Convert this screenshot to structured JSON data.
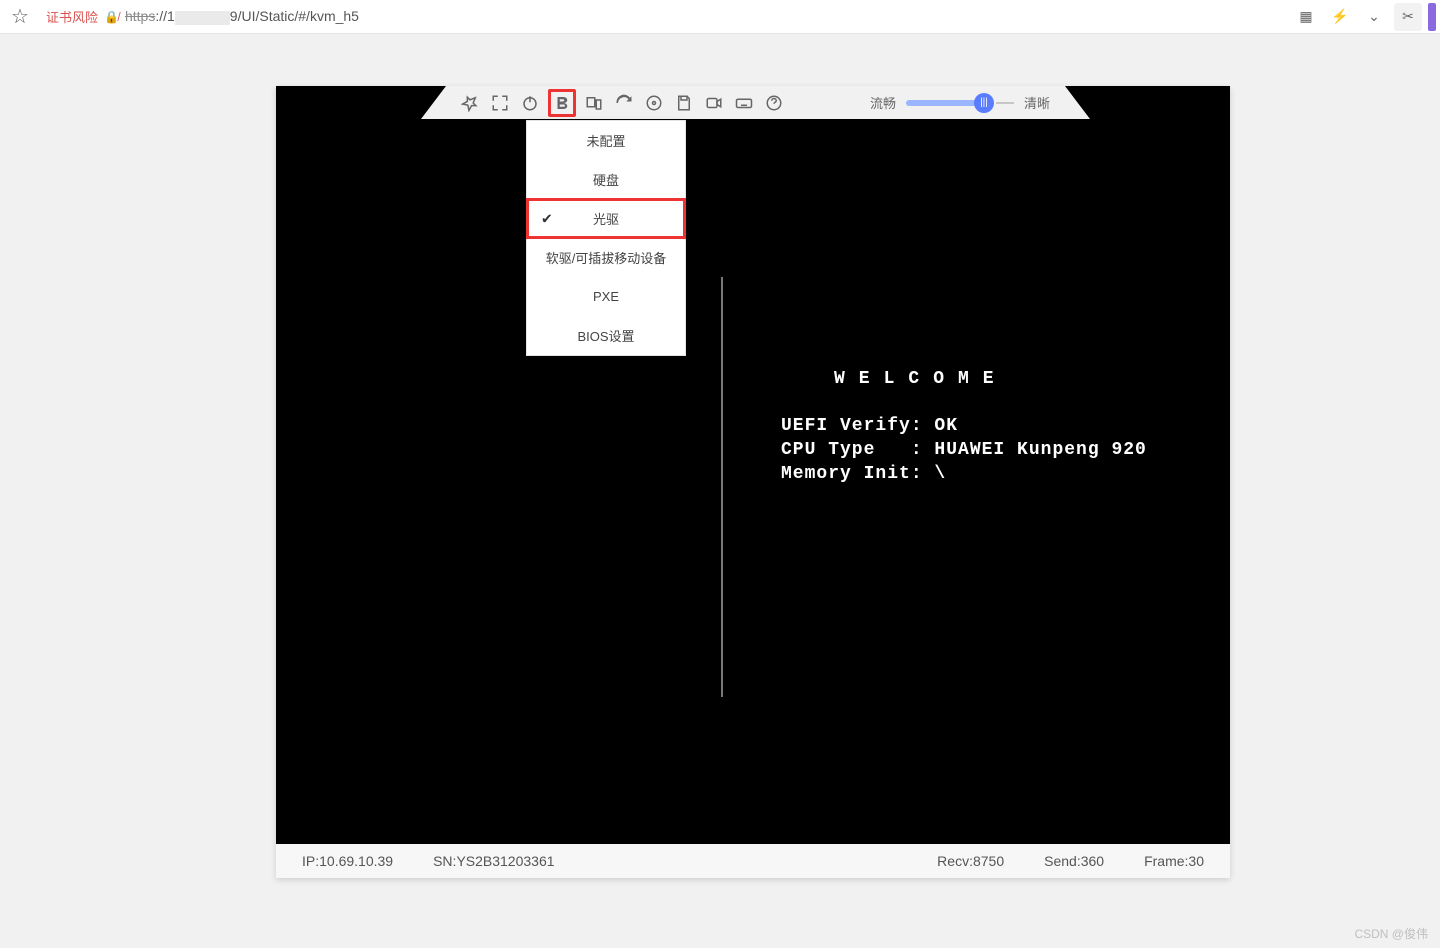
{
  "browser": {
    "cert_warning": "证书风险",
    "url_scheme": "https",
    "url_prefix": "://1",
    "url_suffix": "9/UI/Static/#/kvm_h5"
  },
  "toolbar": {
    "quality_left": "流畅",
    "quality_right": "清晰"
  },
  "dropdown": {
    "items": [
      {
        "label": "未配置",
        "checked": false
      },
      {
        "label": "硬盘",
        "checked": false
      },
      {
        "label": "光驱",
        "checked": true,
        "highlight": true
      },
      {
        "label": "软驱/可插拔移动设备",
        "checked": false
      },
      {
        "label": "PXE",
        "checked": false
      },
      {
        "label": "BIOS设置",
        "checked": false
      }
    ]
  },
  "console": {
    "welcome": "WELCOME",
    "line1": "UEFI Verify: OK",
    "line2": "CPU Type   : HUAWEI Kunpeng 920",
    "line3": "Memory Init: \\"
  },
  "status": {
    "ip_label": "IP:",
    "ip": "10.69.10.39",
    "sn_label": "SN:",
    "sn": "YS2B31203361",
    "recv_label": "Recv:",
    "recv": "8750",
    "send_label": "Send:",
    "send": "360",
    "frame_label": "Frame:",
    "frame": "30"
  },
  "watermark": "CSDN @俊伟"
}
